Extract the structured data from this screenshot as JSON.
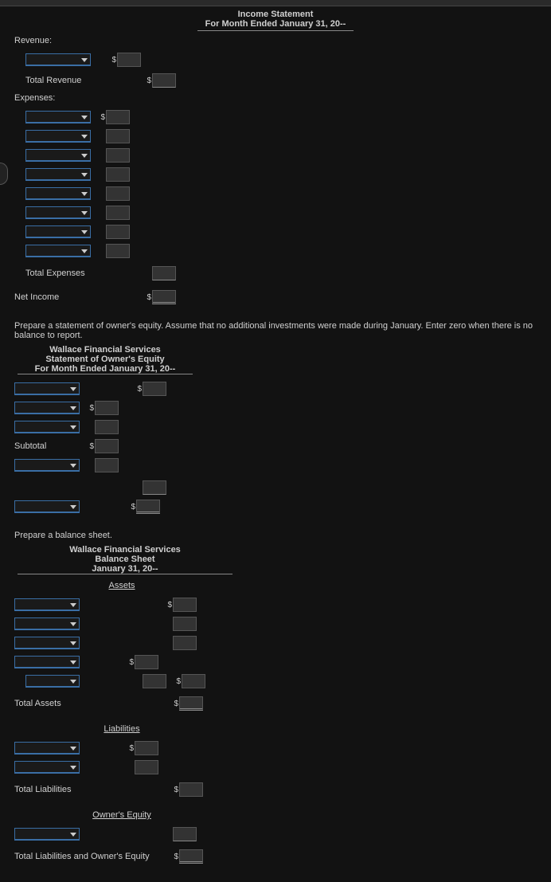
{
  "income_statement": {
    "title_line1": "Income Statement",
    "title_line2": "For Month Ended January 31, 20--",
    "revenue_label": "Revenue:",
    "total_revenue_label": "Total Revenue",
    "expenses_label": "Expenses:",
    "total_expenses_label": "Total Expenses",
    "net_income_label": "Net Income"
  },
  "owners_equity": {
    "instruction": "Prepare a statement of owner's equity. Assume that no additional investments were made during January. Enter zero when there is no balance to report.",
    "title_line1": "Wallace Financial Services",
    "title_line2": "Statement of Owner's Equity",
    "title_line3": "For Month Ended January 31, 20--",
    "subtotal_label": "Subtotal"
  },
  "balance_sheet": {
    "instruction": "Prepare a balance sheet.",
    "title_line1": "Wallace Financial Services",
    "title_line2": "Balance Sheet",
    "title_line3": "January 31, 20--",
    "assets_label": "Assets",
    "total_assets_label": "Total Assets",
    "liabilities_label": "Liabilities",
    "total_liabilities_label": "Total Liabilities",
    "owners_equity_label": "Owner's Equity",
    "total_liab_oe_label": "Total Liabilities and Owner's Equity"
  }
}
